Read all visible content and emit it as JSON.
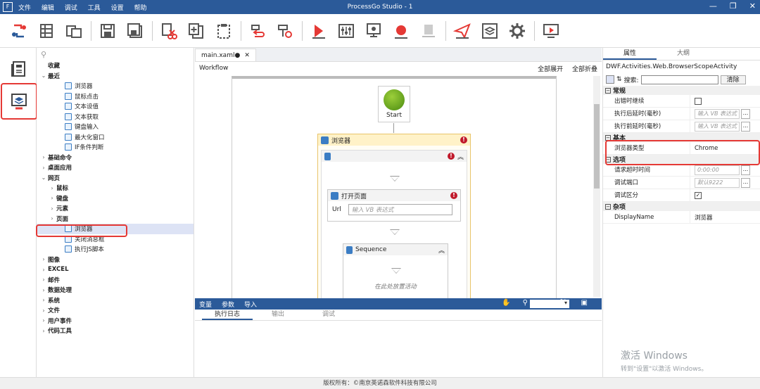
{
  "app": {
    "title": "ProcessGo Studio - 1",
    "logo": "F",
    "menu": [
      "文件",
      "编辑",
      "调试",
      "工具",
      "设置",
      "帮助"
    ],
    "window_controls": [
      "—",
      "❐",
      "✕"
    ]
  },
  "toolbar": {
    "buttons": [
      "flow-link-icon",
      "table-icon",
      "open-folder-icon",
      "save-icon",
      "save-all-icon",
      "cut-icon",
      "copy-add-icon",
      "paste-icon",
      "undo-icon",
      "redo-icon",
      "run-icon",
      "debug-settings-icon",
      "record-icon",
      "stop-icon",
      "clear-icon",
      "publish-icon",
      "package-icon",
      "gear-icon",
      "screen-play-icon"
    ]
  },
  "tree": {
    "search_icon": "search-icon",
    "items": [
      {
        "label": "收藏",
        "level": 0,
        "arrow": "",
        "bold": true,
        "icon": false
      },
      {
        "label": "最近",
        "level": 0,
        "arrow": "⌄",
        "bold": true,
        "icon": false
      },
      {
        "label": "浏览器",
        "level": 2,
        "arrow": "",
        "bold": false,
        "icon": true
      },
      {
        "label": "鼠标点击",
        "level": 2,
        "arrow": "",
        "bold": false,
        "icon": true
      },
      {
        "label": "文本设值",
        "level": 2,
        "arrow": "",
        "bold": false,
        "icon": true
      },
      {
        "label": "文本获取",
        "level": 2,
        "arrow": "",
        "bold": false,
        "icon": true
      },
      {
        "label": "键盘输入",
        "level": 2,
        "arrow": "",
        "bold": false,
        "icon": true
      },
      {
        "label": "最大化窗口",
        "level": 2,
        "arrow": "",
        "bold": false,
        "icon": true
      },
      {
        "label": "IF条件判断",
        "level": 2,
        "arrow": "",
        "bold": false,
        "icon": true
      },
      {
        "label": "基础命令",
        "level": 0,
        "arrow": "›",
        "bold": true,
        "icon": false
      },
      {
        "label": "桌面应用",
        "level": 0,
        "arrow": "›",
        "bold": true,
        "icon": false
      },
      {
        "label": "网页",
        "level": 0,
        "arrow": "⌄",
        "bold": true,
        "icon": false
      },
      {
        "label": "鼠标",
        "level": 1,
        "arrow": "›",
        "bold": true,
        "icon": false
      },
      {
        "label": "键盘",
        "level": 1,
        "arrow": "›",
        "bold": true,
        "icon": false
      },
      {
        "label": "元素",
        "level": 1,
        "arrow": "›",
        "bold": true,
        "icon": false
      },
      {
        "label": "页面",
        "level": 1,
        "arrow": "›",
        "bold": true,
        "icon": false
      },
      {
        "label": "浏览器",
        "level": 2,
        "arrow": "",
        "bold": false,
        "icon": true,
        "selected": true
      },
      {
        "label": "关闭消息框",
        "level": 2,
        "arrow": "",
        "bold": false,
        "icon": true
      },
      {
        "label": "执行JS脚本",
        "level": 2,
        "arrow": "",
        "bold": false,
        "icon": true
      },
      {
        "label": "图像",
        "level": 0,
        "arrow": "›",
        "bold": true,
        "icon": false
      },
      {
        "label": "EXCEL",
        "level": 0,
        "arrow": "›",
        "bold": true,
        "icon": false
      },
      {
        "label": "邮件",
        "level": 0,
        "arrow": "›",
        "bold": true,
        "icon": false
      },
      {
        "label": "数据处理",
        "level": 0,
        "arrow": "›",
        "bold": true,
        "icon": false
      },
      {
        "label": "系统",
        "level": 0,
        "arrow": "›",
        "bold": true,
        "icon": false
      },
      {
        "label": "文件",
        "level": 0,
        "arrow": "›",
        "bold": true,
        "icon": false
      },
      {
        "label": "用户事件",
        "level": 0,
        "arrow": "›",
        "bold": true,
        "icon": false
      },
      {
        "label": "代码工具",
        "level": 0,
        "arrow": "›",
        "bold": true,
        "icon": false
      }
    ]
  },
  "editor": {
    "tab_label": "main.xaml●",
    "tab_close": "✕",
    "breadcrumb": "Workflow",
    "expand_all": "全部展开",
    "collapse_all": "全部折叠",
    "start_label": "Start",
    "browser_activity": {
      "title": "浏览器",
      "error": "!"
    },
    "open_page": {
      "title": "打开页面",
      "url_label": "Url",
      "url_placeholder": "输入 VB 表达式"
    },
    "sequence": {
      "title": "Sequence",
      "drop_hint": "在此处放置活动"
    }
  },
  "bottom": {
    "var_tabs": [
      "变量",
      "参数",
      "导入"
    ],
    "output_tabs": [
      "执行日志",
      "输出",
      "调试"
    ],
    "active_output": "执行日志"
  },
  "properties": {
    "tabs": [
      "属性",
      "大纲"
    ],
    "active_tab": "属性",
    "type_name": "DWF.Activities.Web.BrowserScopeActivity",
    "search_label": "搜索:",
    "clear_label": "清除",
    "categories": [
      {
        "name": "常规",
        "props": [
          {
            "name": "出错时继续",
            "kind": "check",
            "checked": false
          },
          {
            "name": "执行后延时(毫秒)",
            "kind": "input",
            "value": "输入 VB 表达式"
          },
          {
            "name": "执行前延时(毫秒)",
            "kind": "input",
            "value": "输入 VB 表达式"
          }
        ]
      },
      {
        "name": "基本",
        "props": [
          {
            "name": "浏览器类型",
            "kind": "text",
            "value": "Chrome"
          }
        ]
      },
      {
        "name": "选项",
        "props": [
          {
            "name": "请求超时时间",
            "kind": "input",
            "value": "0:00:00"
          },
          {
            "name": "调试端口",
            "kind": "input",
            "value": "默认9222"
          },
          {
            "name": "调试区分",
            "kind": "check",
            "checked": true
          }
        ]
      },
      {
        "name": "杂项",
        "props": [
          {
            "name": "DisplayName",
            "kind": "text",
            "value": "浏览器"
          }
        ]
      }
    ]
  },
  "watermark": {
    "line1": "激活 Windows",
    "line2": "转到\"设置\"以激活 Windows。"
  },
  "footer": "版权所有：©南京英诺森软件科技有限公司",
  "colors": {
    "accent": "#2b5a99",
    "highlight": "#e53935",
    "error": "#c0192b"
  }
}
